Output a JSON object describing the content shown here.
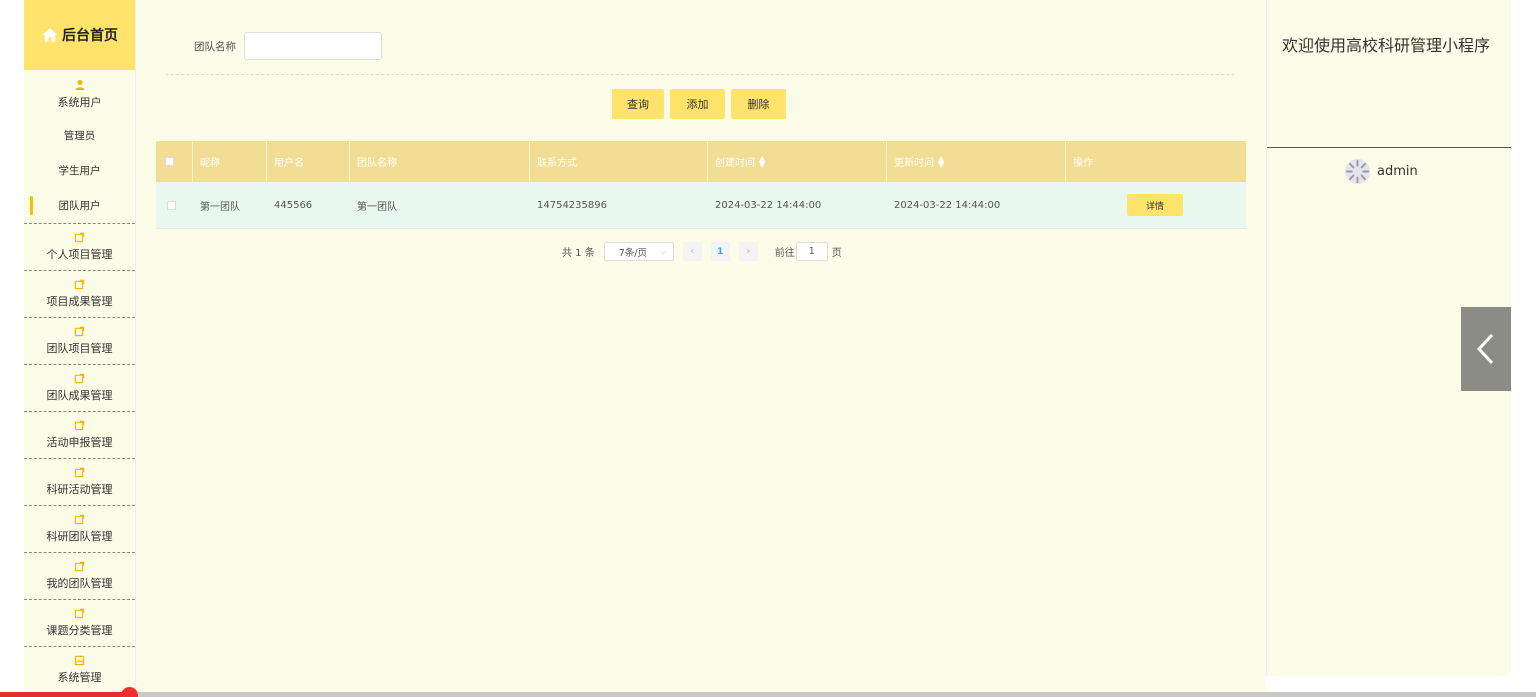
{
  "sidebar": {
    "home_label": "后台首页",
    "system_user": {
      "label": "系统用户",
      "items": [
        {
          "label": "管理员"
        },
        {
          "label": "学生用户"
        },
        {
          "label": "团队用户"
        }
      ]
    },
    "categories": [
      {
        "label": "个人项目管理"
      },
      {
        "label": "项目成果管理"
      },
      {
        "label": "团队项目管理"
      },
      {
        "label": "团队成果管理"
      },
      {
        "label": "活动申报管理"
      },
      {
        "label": "科研活动管理"
      },
      {
        "label": "科研团队管理"
      },
      {
        "label": "我的团队管理"
      },
      {
        "label": "课题分类管理"
      },
      {
        "label": "系统管理"
      }
    ]
  },
  "search": {
    "label": "团队名称",
    "value": ""
  },
  "actions": {
    "query": "查询",
    "add": "添加",
    "delete": "删除"
  },
  "table": {
    "headers": [
      "昵称",
      "用户名",
      "团队名称",
      "联系方式",
      "创建时间",
      "更新时间",
      "操作"
    ],
    "rows": [
      {
        "nickname": "第一团队",
        "username": "445566",
        "team": "第一团队",
        "phone": "14754235896",
        "created": "2024-03-22 14:44:00",
        "updated": "2024-03-22 14:44:00",
        "action": "详情"
      }
    ]
  },
  "pagination": {
    "total": "共 1 条",
    "page_size": "7条/页",
    "current_page": "1",
    "goto_label": "前往",
    "goto_value": "1",
    "page_unit": "页"
  },
  "header": {
    "welcome": "欢迎使用高校科研管理小程序",
    "username": "admin"
  },
  "colors": {
    "accent": "#ffe36a",
    "header_bg": "#f1dd93",
    "row_bg": "#e8f8ee",
    "panel_bg": "#fbfde8",
    "icon": "#f5b400"
  },
  "icons": {
    "home": "home-icon",
    "user": "user-icon",
    "menu": "edit-square-icon",
    "system": "image-icon",
    "collapse": "chevron-left-icon",
    "avatar": "loading-avatar-icon"
  }
}
